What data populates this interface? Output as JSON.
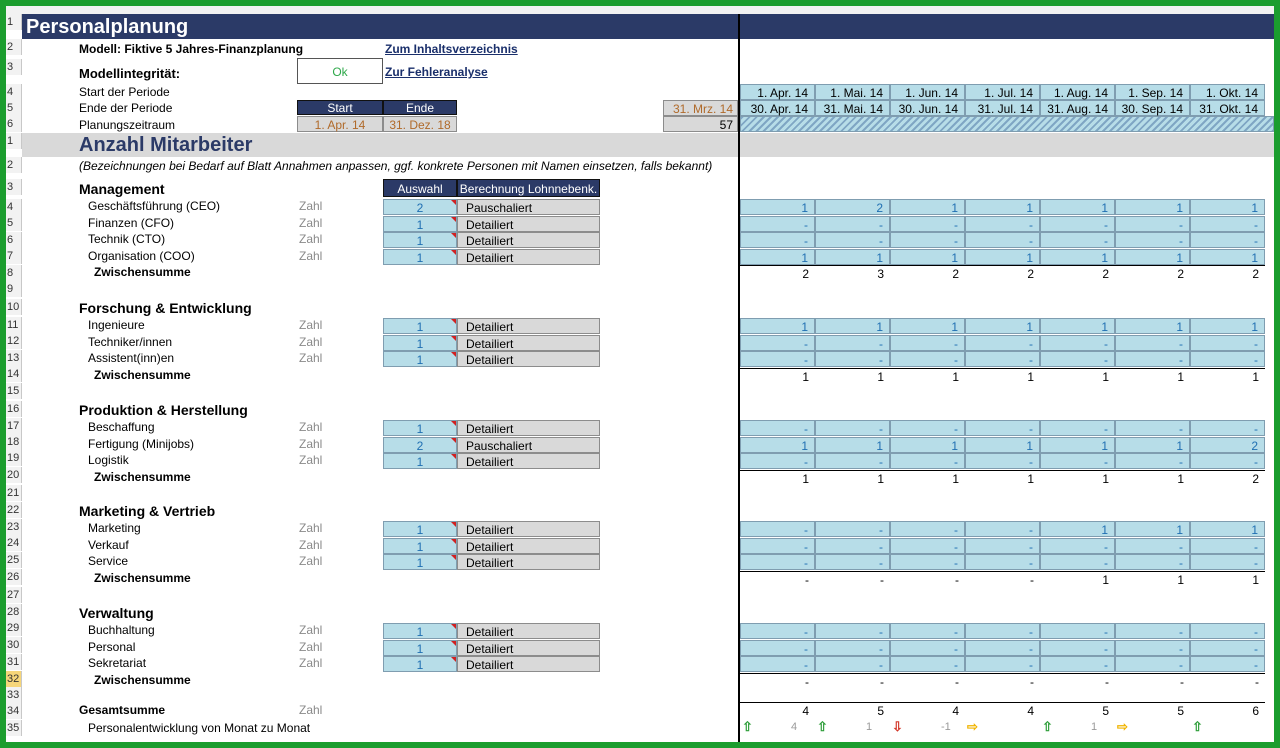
{
  "title": "Personalplanung",
  "model_label": "Modell: Fiktive 5 Jahres-Finanzplanung",
  "link_toc": "Zum Inhaltsverzeichnis",
  "link_errors": "Zur Fehleranalyse",
  "integrity_label": "Modellintegrität:",
  "integrity_value": "Ok",
  "period_start_label": "Start der Periode",
  "period_end_label": "Ende der Periode",
  "planning_label": "Planungszeitraum",
  "start_header": "Start",
  "end_header": "Ende",
  "start_value": "1. Apr. 14",
  "end_value": "31. Dez. 18",
  "pre_end": "31. Mrz. 14",
  "count_months": "57",
  "month_starts": [
    "1. Apr. 14",
    "1. Mai. 14",
    "1. Jun. 14",
    "1. Jul. 14",
    "1. Aug. 14",
    "1. Sep. 14",
    "1. Okt. 14"
  ],
  "month_ends": [
    "30. Apr. 14",
    "31. Mai. 14",
    "30. Jun. 14",
    "31. Jul. 14",
    "31. Aug. 14",
    "30. Sep. 14",
    "31. Okt. 14"
  ],
  "section_title": "Anzahl Mitarbeiter",
  "section_note": "(Bezeichnungen bei Bedarf auf Blatt Annahmen anpassen, ggf. konkrete Personen mit Namen einsetzen, falls bekannt)",
  "col_auswahl": "Auswahl",
  "col_berechnung": "Berechnung Lohnnebenk.",
  "zahl": "Zahl",
  "subtotal_label": "Zwischensumme",
  "groups": [
    {
      "name": "Management",
      "items": [
        {
          "label": "Geschäftsführung (CEO)",
          "sel": "2",
          "calc": "Pauschaliert",
          "months": [
            "1",
            "2",
            "1",
            "1",
            "1",
            "1",
            "1"
          ]
        },
        {
          "label": "Finanzen (CFO)",
          "sel": "1",
          "calc": "Detailiert",
          "months": [
            "-",
            "-",
            "-",
            "-",
            "-",
            "-",
            "-"
          ]
        },
        {
          "label": "Technik (CTO)",
          "sel": "1",
          "calc": "Detailiert",
          "months": [
            "-",
            "-",
            "-",
            "-",
            "-",
            "-",
            "-"
          ]
        },
        {
          "label": "Organisation (COO)",
          "sel": "1",
          "calc": "Detailiert",
          "months": [
            "1",
            "1",
            "1",
            "1",
            "1",
            "1",
            "1"
          ]
        }
      ],
      "subtotal": [
        "2",
        "3",
        "2",
        "2",
        "2",
        "2",
        "2"
      ]
    },
    {
      "name": "Forschung & Entwicklung",
      "items": [
        {
          "label": "Ingenieure",
          "sel": "1",
          "calc": "Detailiert",
          "months": [
            "1",
            "1",
            "1",
            "1",
            "1",
            "1",
            "1"
          ]
        },
        {
          "label": "Techniker/innen",
          "sel": "1",
          "calc": "Detailiert",
          "months": [
            "-",
            "-",
            "-",
            "-",
            "-",
            "-",
            "-"
          ]
        },
        {
          "label": "Assistent(inn)en",
          "sel": "1",
          "calc": "Detailiert",
          "months": [
            "-",
            "-",
            "-",
            "-",
            "-",
            "-",
            "-"
          ]
        }
      ],
      "subtotal": [
        "1",
        "1",
        "1",
        "1",
        "1",
        "1",
        "1"
      ]
    },
    {
      "name": "Produktion & Herstellung",
      "items": [
        {
          "label": "Beschaffung",
          "sel": "1",
          "calc": "Detailiert",
          "months": [
            "-",
            "-",
            "-",
            "-",
            "-",
            "-",
            "-"
          ]
        },
        {
          "label": "Fertigung (Minijobs)",
          "sel": "2",
          "calc": "Pauschaliert",
          "months": [
            "1",
            "1",
            "1",
            "1",
            "1",
            "1",
            "2"
          ]
        },
        {
          "label": "Logistik",
          "sel": "1",
          "calc": "Detailiert",
          "months": [
            "-",
            "-",
            "-",
            "-",
            "-",
            "-",
            "-"
          ]
        }
      ],
      "subtotal": [
        "1",
        "1",
        "1",
        "1",
        "1",
        "1",
        "2"
      ]
    },
    {
      "name": "Marketing & Vertrieb",
      "items": [
        {
          "label": "Marketing",
          "sel": "1",
          "calc": "Detailiert",
          "months": [
            "-",
            "-",
            "-",
            "-",
            "1",
            "1",
            "1"
          ]
        },
        {
          "label": "Verkauf",
          "sel": "1",
          "calc": "Detailiert",
          "months": [
            "-",
            "-",
            "-",
            "-",
            "-",
            "-",
            "-"
          ]
        },
        {
          "label": "Service",
          "sel": "1",
          "calc": "Detailiert",
          "months": [
            "-",
            "-",
            "-",
            "-",
            "-",
            "-",
            "-"
          ]
        }
      ],
      "subtotal": [
        "-",
        "-",
        "-",
        "-",
        "1",
        "1",
        "1"
      ]
    },
    {
      "name": "Verwaltung",
      "items": [
        {
          "label": "Buchhaltung",
          "sel": "1",
          "calc": "Detailiert",
          "months": [
            "-",
            "-",
            "-",
            "-",
            "-",
            "-",
            "-"
          ]
        },
        {
          "label": "Personal",
          "sel": "1",
          "calc": "Detailiert",
          "months": [
            "-",
            "-",
            "-",
            "-",
            "-",
            "-",
            "-"
          ]
        },
        {
          "label": "Sekretariat",
          "sel": "1",
          "calc": "Detailiert",
          "months": [
            "-",
            "-",
            "-",
            "-",
            "-",
            "-",
            "-"
          ]
        }
      ],
      "subtotal": [
        "-",
        "-",
        "-",
        "-",
        "-",
        "-",
        "-"
      ]
    }
  ],
  "total_label": "Gesamtsumme",
  "total_zahl": "Zahl",
  "totals": [
    "4",
    "5",
    "4",
    "4",
    "5",
    "5",
    "6"
  ],
  "dev_label": "Personalentwicklung von Monat zu Monat",
  "dev_values": [
    "4",
    "1",
    "-1",
    "",
    "1",
    "",
    ""
  ],
  "dev_arrows": [
    "up",
    "up",
    "down",
    "right",
    "up",
    "right",
    "up"
  ],
  "row_numbers": [
    "1",
    "2",
    "3",
    "4",
    "5",
    "6",
    "1",
    "2",
    "3",
    "4",
    "5",
    "6",
    "7",
    "8",
    "9",
    "10",
    "11",
    "12",
    "13",
    "14",
    "15",
    "16",
    "17",
    "18",
    "19",
    "20",
    "21",
    "22",
    "23",
    "24",
    "25",
    "26",
    "27",
    "28",
    "29",
    "30",
    "31",
    "32",
    "33",
    "34",
    "35"
  ],
  "colors": {
    "header_navy": "#2b3a67",
    "cell_blue": "#b7dde8",
    "cell_grey": "#d9d9d9",
    "frame_green": "#1b9d2e",
    "arrow_green": "#2e9e3a",
    "arrow_red": "#d33a2c",
    "arrow_yellow": "#f0b400"
  }
}
